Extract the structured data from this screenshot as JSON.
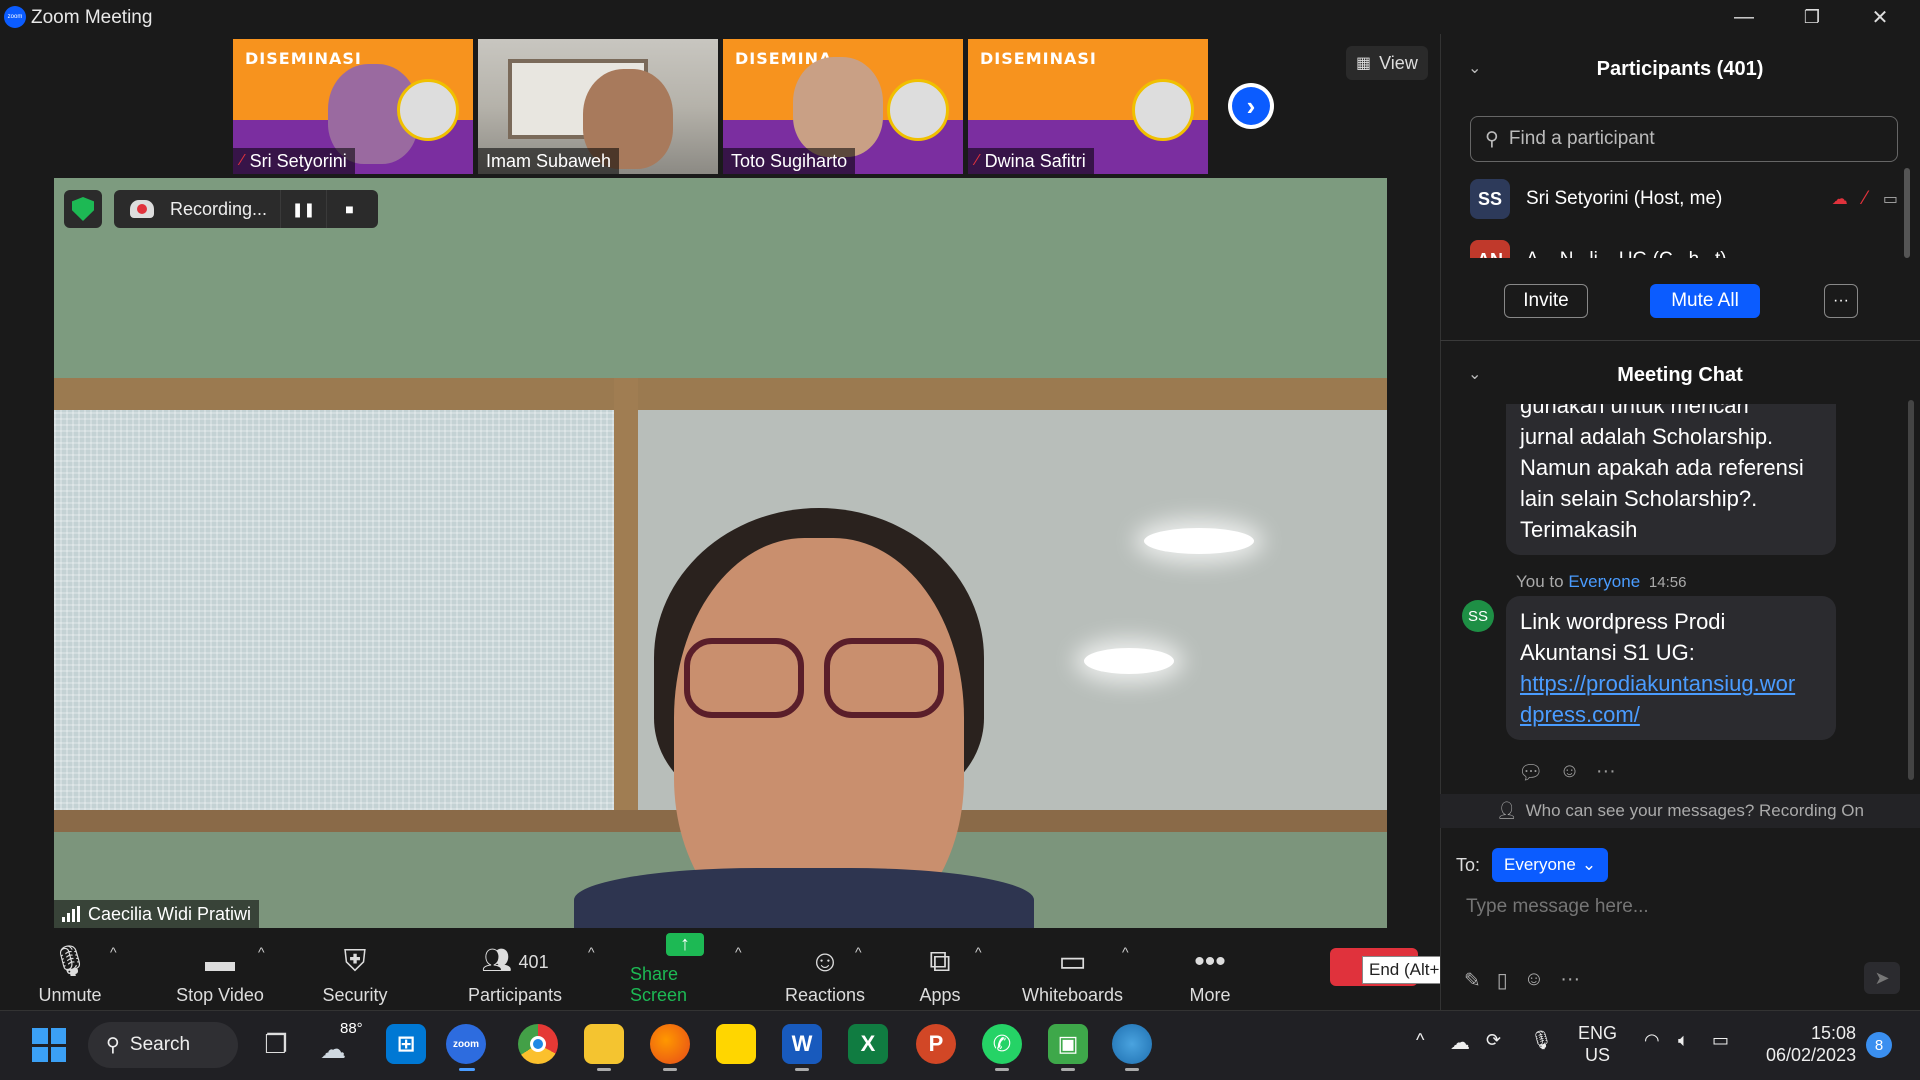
{
  "window": {
    "title": "Zoom Meeting",
    "app_icon_text": "zoom",
    "minimize": "—",
    "restore": "❐",
    "close": "✕"
  },
  "thumbnails": [
    {
      "name": "Sri Setyorini",
      "muted": true,
      "slide_text": "DISEMINASI"
    },
    {
      "name": "Imam Subaweh",
      "muted": false,
      "slide_text": ""
    },
    {
      "name": "Toto Sugiharto",
      "muted": false,
      "slide_text": "DISEMINA"
    },
    {
      "name": "Dwina Safitri",
      "muted": true,
      "slide_text": "DISEMINASI"
    }
  ],
  "view_button": "View",
  "recording": {
    "label": "Recording...",
    "pause": "❚❚",
    "stop": "■"
  },
  "active_speaker": "Caecilia Widi Pratiwi",
  "toolbar": {
    "unmute": "Unmute",
    "stop_video": "Stop Video",
    "security": "Security",
    "participants": "Participants",
    "participants_count": "401",
    "share_screen": "Share Screen",
    "reactions": "Reactions",
    "apps": "Apps",
    "whiteboards": "Whiteboards",
    "more": "More",
    "end_tooltip": "End (Alt+Q)"
  },
  "participants_panel": {
    "title": "Participants (401)",
    "search_placeholder": "Find a participant",
    "rows": [
      {
        "initials": "SS",
        "name": "Sri Setyorini (Host, me)",
        "color": "#2d3a5a"
      },
      {
        "initials": "AN",
        "name": "A... N...li... UG (C...h...t)",
        "color": "#c0392b"
      }
    ],
    "invite": "Invite",
    "mute_all": "Mute All",
    "more": "···"
  },
  "chat": {
    "title": "Meeting Chat",
    "prev_message": {
      "partial_line": "gunakan untuk mencari",
      "lines": [
        "jurnal adalah Scholarship.",
        "Namun apakah ada referensi",
        "lain selain Scholarship?.",
        "Terimakasih"
      ]
    },
    "last_message": {
      "sender_prefix": "You to",
      "recipient": "Everyone",
      "time": "14:56",
      "avatar": "SS",
      "text_line1": "Link wordpress Prodi",
      "text_line2": "Akuntansi S1 UG:",
      "link_line1": "https://prodiakuntansiug.wor",
      "link_line2": "dpress.com/"
    },
    "privacy_note": "Who can see your messages? Recording On",
    "to_label": "To:",
    "to_value": "Everyone",
    "input_placeholder": "Type message here..."
  },
  "taskbar": {
    "search": "Search",
    "weather": "88°",
    "lang_top": "ENG",
    "lang_bottom": "US",
    "time": "15:08",
    "date": "06/02/2023",
    "notifications": "8"
  },
  "colors": {
    "zoom_blue": "#0b5cff",
    "end_red": "#e0323c",
    "share_green": "#1db954",
    "chat_link": "#4a9cff"
  }
}
